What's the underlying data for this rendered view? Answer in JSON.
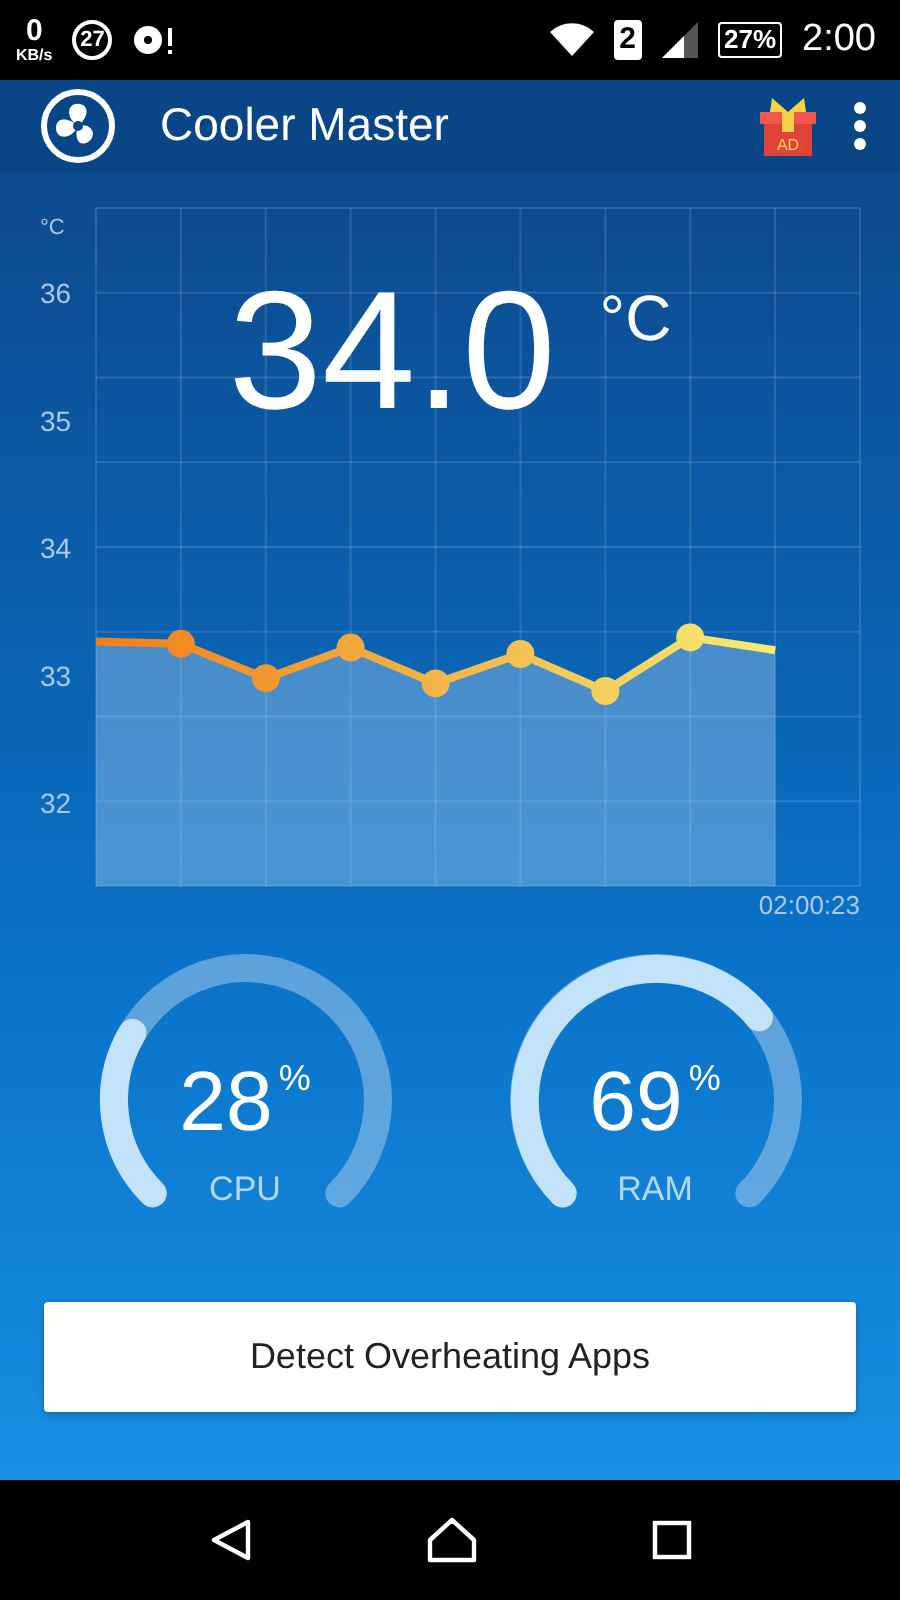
{
  "status_bar": {
    "speed": "0",
    "speed_unit": "KB/s",
    "notification_count": "27",
    "sim_slot": "2",
    "battery": "27%",
    "time": "2:00"
  },
  "app_bar": {
    "title": "Cooler Master",
    "ad_label": "AD"
  },
  "temperature": {
    "reading": "34.0",
    "unit": "°C"
  },
  "chart": {
    "timestamp": "02:00:23",
    "chart_data": {
      "type": "area",
      "ylabel": "°C",
      "categories": [
        null,
        null,
        null,
        null,
        null,
        null,
        null,
        null,
        null
      ],
      "grid": true,
      "ylim": [
        31.35,
        36.67
      ],
      "yticks": [
        32,
        33,
        34,
        35,
        36
      ],
      "series": [
        {
          "color": "#f07d1a",
          "values": [
            33.27,
            33.25,
            32.98,
            33.22,
            32.94,
            33.17,
            32.88,
            33.3,
            33.2
          ]
        }
      ]
    }
  },
  "gauges": [
    {
      "label": "CPU",
      "value": "28",
      "unit": "%"
    },
    {
      "label": "RAM",
      "value": "69",
      "unit": "%"
    }
  ],
  "action_button": {
    "label": "Detect Overheating Apps"
  }
}
